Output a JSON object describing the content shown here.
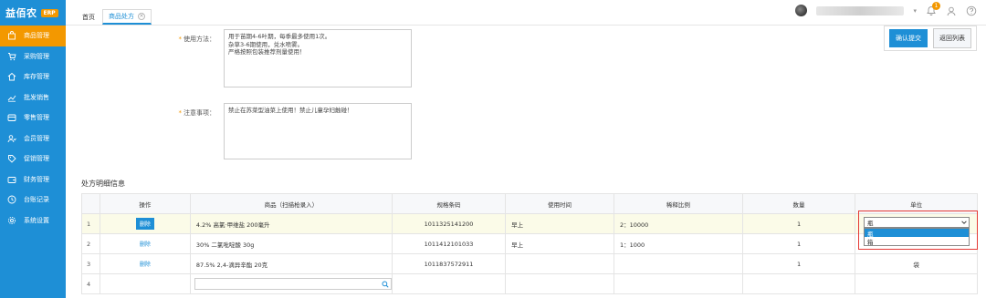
{
  "brand": {
    "name": "益佰农",
    "badge": "ERP"
  },
  "sidebar": {
    "items": [
      {
        "label": "商品管理",
        "icon": "bag-icon",
        "active": true
      },
      {
        "label": "采购管理",
        "icon": "cart-icon",
        "active": false
      },
      {
        "label": "库存管理",
        "icon": "home-icon",
        "active": false
      },
      {
        "label": "批发销售",
        "icon": "trend-icon",
        "active": false
      },
      {
        "label": "零售管理",
        "icon": "register-icon",
        "active": false
      },
      {
        "label": "会员管理",
        "icon": "member-icon",
        "active": false
      },
      {
        "label": "促销管理",
        "icon": "tag-icon",
        "active": false
      },
      {
        "label": "财务管理",
        "icon": "wallet-icon",
        "active": false
      },
      {
        "label": "台账记录",
        "icon": "clock-icon",
        "active": false
      },
      {
        "label": "系统设置",
        "icon": "gear-icon",
        "active": false
      }
    ]
  },
  "tabs": {
    "home": "首页",
    "active": "商品处方"
  },
  "header": {
    "notification_count": "1"
  },
  "actions": {
    "confirm": "确认提交",
    "back": "返回列表"
  },
  "form": {
    "usage_label": "使用方法：",
    "usage_value": "用于苗期4-6叶期，每季最多使用1次。\n杂草3-6期使用，兑水喷雾。\n严格按照包装推荐剂量使用！",
    "notes_label": "注意事项：",
    "notes_value": "禁止在苏菜型油菜上使用！禁止儿童孕妇触碰！"
  },
  "section_title": "处方明细信息",
  "table": {
    "headers": [
      "操作",
      "商品（扫描枪录入）",
      "规格条码",
      "使用时间",
      "稀释比例",
      "数量",
      "单位"
    ],
    "rows": [
      {
        "no": "1",
        "action": "删除",
        "product": "4.2% 高氯·甲维盐 200毫升",
        "barcode": "1011325141200",
        "time": "早上",
        "ratio": "2：10000",
        "qty": "1",
        "unit": ""
      },
      {
        "no": "2",
        "action": "删除",
        "product": "30% 二氯吡啶酸 30g",
        "barcode": "1011412101033",
        "time": "早上",
        "ratio": "1：1000",
        "qty": "1",
        "unit": ""
      },
      {
        "no": "3",
        "action": "删除",
        "product": "87.5% 2,4-滴异辛酯 20克",
        "barcode": "1011837572911",
        "time": "",
        "ratio": "",
        "qty": "1",
        "unit": "袋"
      },
      {
        "no": "4",
        "action": "",
        "product": "",
        "barcode": "",
        "time": "",
        "ratio": "",
        "qty": "",
        "unit": ""
      }
    ]
  },
  "unit_select": {
    "selected": "瓶",
    "options": [
      "瓶",
      "箱"
    ]
  },
  "colors": {
    "brand": "#1e8fd6",
    "accent": "#f39800",
    "highlight": "#e53935"
  }
}
